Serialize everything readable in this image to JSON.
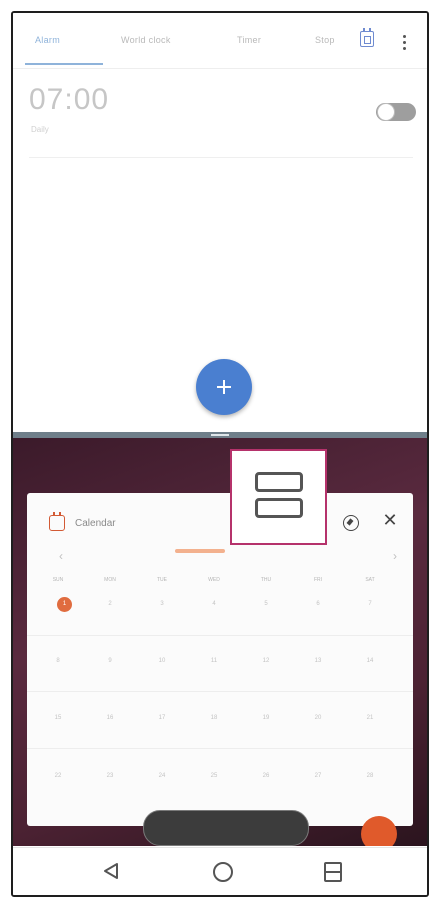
{
  "top_app": {
    "tabs": [
      {
        "label": "Alarm",
        "active": true
      },
      {
        "label": "World clock",
        "active": false
      },
      {
        "label": "Timer",
        "active": false
      },
      {
        "label": "Stop",
        "active": false
      }
    ],
    "icons": {
      "calendar": "calendar-icon",
      "more": "more-vert-icon"
    },
    "alarm": {
      "time": "07:00",
      "subtitle": "Daily",
      "enabled": false
    },
    "fab_icon": "add-icon",
    "accent_color": "#4a7fd0"
  },
  "calendar_window": {
    "app_name": "Calendar",
    "month_label": "",
    "weekdays": [
      "SUN",
      "MON",
      "TUE",
      "WED",
      "THU",
      "FRI",
      "SAT"
    ],
    "weeks": [
      [
        "1",
        "2",
        "3",
        "4",
        "5",
        "6",
        "7"
      ],
      [
        "8",
        "9",
        "10",
        "11",
        "12",
        "13",
        "14"
      ],
      [
        "15",
        "16",
        "17",
        "18",
        "19",
        "20",
        "21"
      ],
      [
        "22",
        "23",
        "24",
        "25",
        "26",
        "27",
        "28"
      ]
    ],
    "today": "1",
    "today_color": "#e06c3f",
    "pill_label": "",
    "icons": {
      "app": "calendar-app-icon",
      "compass": "compass-icon",
      "close": "close-icon"
    }
  },
  "split_indicator": {
    "icon": "split-screen-icon",
    "border_color": "#b5326b"
  },
  "navbar": {
    "back": "back-icon",
    "home": "home-icon",
    "recents": "split-recents-icon"
  }
}
